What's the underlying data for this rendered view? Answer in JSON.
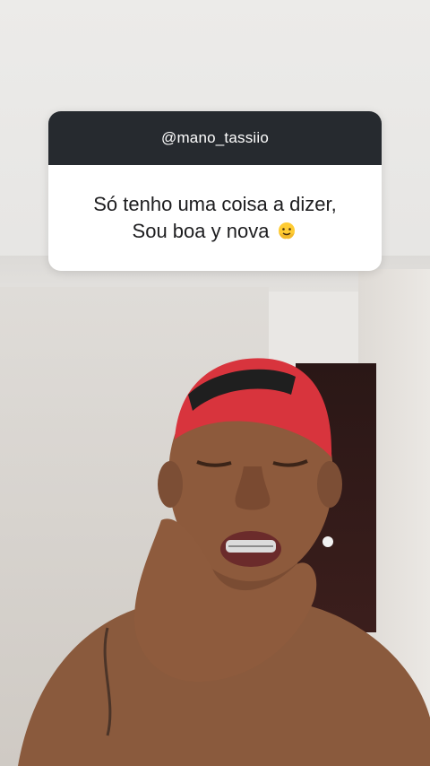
{
  "question_card": {
    "username": "@mano_tassiio",
    "message_line1": "Só tenho uma coisa a dizer,",
    "message_line2": "Sou boa y nova",
    "emoji": "melting-face-emoji"
  },
  "colors": {
    "card_header_bg": "#262a2f",
    "card_body_bg": "#ffffff",
    "text_dark": "#1d1d1f",
    "cap_red": "#d8343d"
  }
}
